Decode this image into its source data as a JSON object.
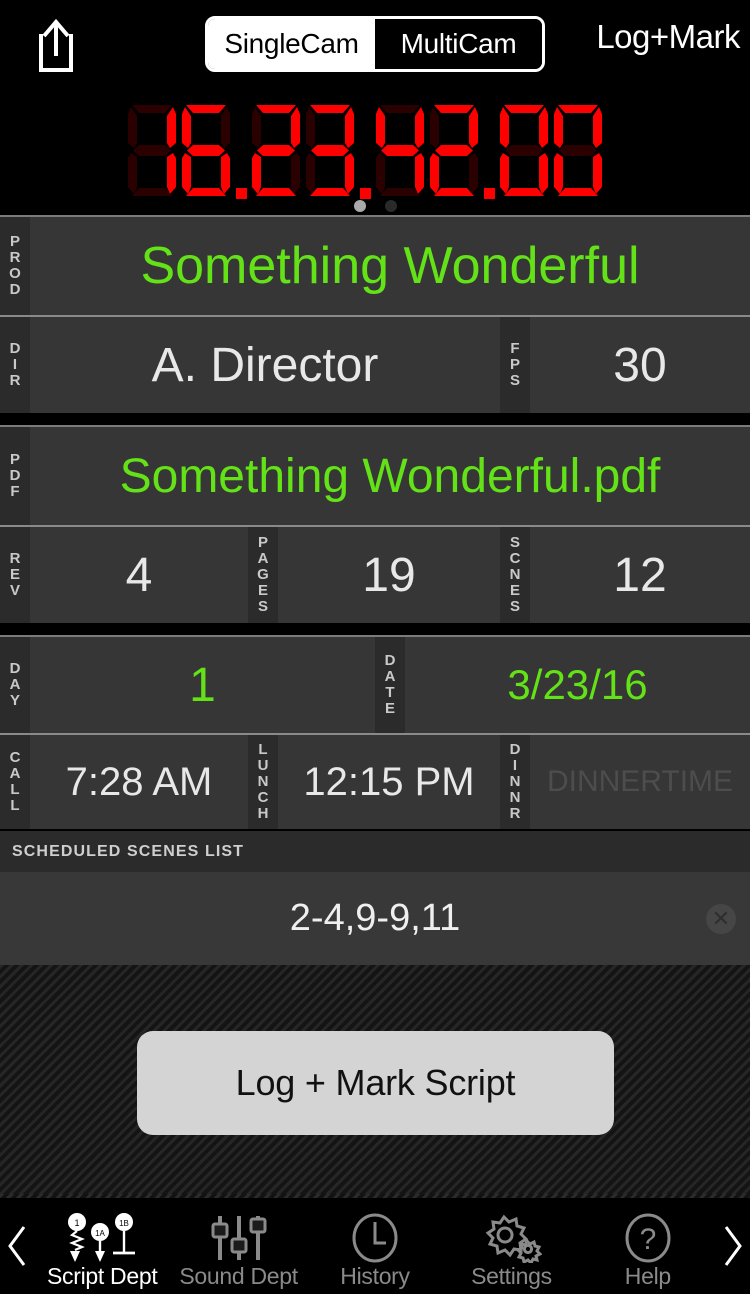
{
  "topbar": {
    "share_icon": "share-icon",
    "segmented": {
      "options": [
        "SingleCam",
        "MultiCam"
      ],
      "selected": "SingleCam"
    },
    "title": "Log+Mark"
  },
  "timecode": {
    "value": "16.23.42.00",
    "color_on": "#ff0000",
    "color_off": "#2a0000",
    "page_dots": {
      "count": 2,
      "active_index": 0
    }
  },
  "fields": {
    "prod": {
      "label": "PROD",
      "value": "Something Wonderful",
      "color": "#63e217"
    },
    "dir": {
      "label": "DIR",
      "value": "A. Director"
    },
    "fps": {
      "label": "FPS",
      "value": "30"
    },
    "pdf": {
      "label": "PDF",
      "value": "Something Wonderful.pdf",
      "color": "#63e217"
    },
    "rev": {
      "label": "REV",
      "value": "4"
    },
    "pages": {
      "label": "PAGES",
      "value": "19"
    },
    "scnes": {
      "label": "SCNES",
      "value": "12"
    },
    "day": {
      "label": "DAY",
      "value": "1",
      "color": "#63e217"
    },
    "date": {
      "label": "DATE",
      "value": "3/23/16",
      "color": "#63e217"
    },
    "call": {
      "label": "CALL",
      "value": "7:28 AM"
    },
    "lunch": {
      "label": "LUNCH",
      "value": "12:15 PM"
    },
    "dinnr": {
      "label": "DINNR",
      "value": "",
      "placeholder": "DINNERTIME"
    }
  },
  "scheduled": {
    "header": "SCHEDULED SCENES LIST",
    "value": "2-4,9-9,11",
    "clear_icon": "✕"
  },
  "action": {
    "log_mark_script": "Log + Mark Script"
  },
  "tabbar": {
    "prev_icon": "chevron-left-icon",
    "next_icon": "chevron-right-icon",
    "items": [
      {
        "label": "Script Dept",
        "icon": "script-marks-icon",
        "active": true,
        "marks": [
          "1",
          "1A",
          "1B"
        ]
      },
      {
        "label": "Sound Dept",
        "icon": "sliders-icon",
        "active": false
      },
      {
        "label": "History",
        "icon": "clock-icon",
        "active": false
      },
      {
        "label": "Settings",
        "icon": "gears-icon",
        "active": false
      },
      {
        "label": "Help",
        "icon": "question-circle-icon",
        "active": false
      }
    ]
  }
}
